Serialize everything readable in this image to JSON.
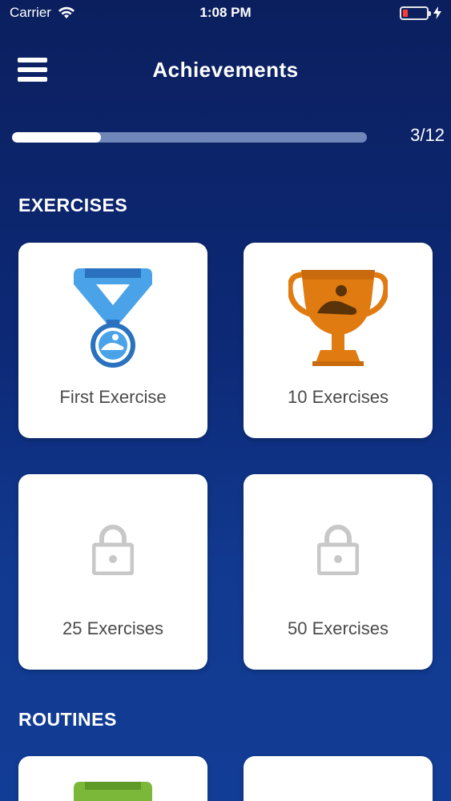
{
  "status": {
    "carrier": "Carrier",
    "time": "1:08 PM"
  },
  "header": {
    "title": "Achievements"
  },
  "progress": {
    "unlocked": 3,
    "total": 12,
    "label": "3/12",
    "fraction": 0.25
  },
  "sections": [
    {
      "title": "EXERCISES",
      "achievements": [
        {
          "label": "First Exercise",
          "icon": "medal-icon",
          "unlocked": true
        },
        {
          "label": "10 Exercises",
          "icon": "trophy-icon",
          "unlocked": true
        },
        {
          "label": "25 Exercises",
          "icon": "lock-icon",
          "unlocked": false
        },
        {
          "label": "50 Exercises",
          "icon": "lock-icon",
          "unlocked": false
        }
      ]
    },
    {
      "title": "ROUTINES",
      "achievements": []
    }
  ],
  "colors": {
    "medal_blue": "#4aa3e8",
    "trophy_orange": "#e07b12",
    "lock_gray": "#c8c8c8",
    "routine_green": "#7bb83a",
    "battery_red": "#ff3b30"
  }
}
